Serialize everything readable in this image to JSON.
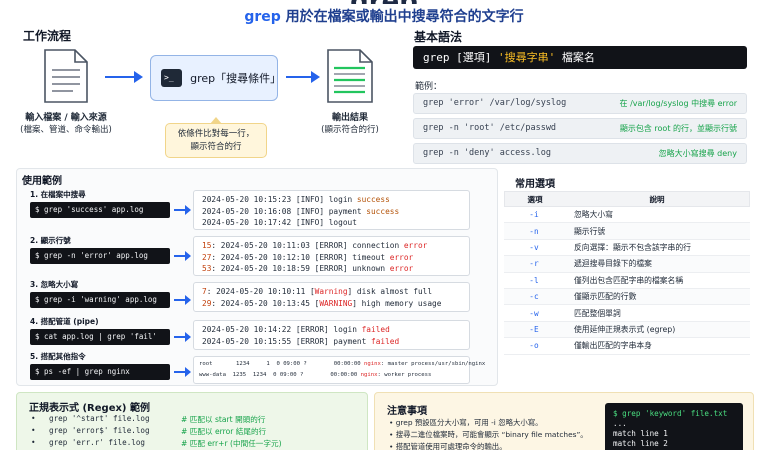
{
  "header": {
    "title": "grep",
    "subtitle_kw": "grep",
    "subtitle_rest": " 用於在檔案或輸出中搜尋符合的文字行"
  },
  "workflow": {
    "title": "工作流程",
    "input_label": "輸入檔案 / 輸入來源",
    "input_sub": "(檔案、管道、命令輸出)",
    "grep_label": "grep「搜尋條件」",
    "note": [
      "依條件比對每一行，",
      "顯示符合的行"
    ],
    "output_label": "輸出結果",
    "output_sub": "(顯示符合的行)"
  },
  "syntax": {
    "title": "基本語法",
    "bar_pre": "grep [選項] ",
    "bar_q": "'搜尋字串'",
    "bar_post": " 檔案名",
    "examples_label": "範例：",
    "examples": [
      {
        "cmd": "grep 'error' /var/log/syslog",
        "desc": "在 /var/log/syslog 中搜尋 error"
      },
      {
        "cmd": "grep -n 'root' /etc/passwd",
        "desc": "顯示包含 root 的行，並顯示行號"
      },
      {
        "cmd": "grep -n 'deny' access.log",
        "desc": "忽略大小寫搜尋 deny"
      }
    ]
  },
  "usage": {
    "title": "使用範例",
    "items": [
      {
        "title": "1. 在檔案中搜尋",
        "cmd": "$ grep 'success' app.log",
        "lines": [
          [
            "2024-05-20 10:15:23 [INFO] login ",
            "success",
            ""
          ],
          [
            "2024-05-20 10:16:08 [INFO] payment ",
            "success",
            ""
          ],
          [
            "2024-05-20 10:17:42 [INFO] logout",
            "",
            ""
          ]
        ]
      },
      {
        "title": "2. 顯示行號",
        "cmd": "$ grep -n 'error' app.log",
        "lines": [
          [
            "15",
            ": 2024-05-20 10:11:03 [ERROR] connection ",
            "error"
          ],
          [
            "27",
            ": 2024-05-20 10:12:10 [ERROR] timeout ",
            "error"
          ],
          [
            "53",
            ": 2024-05-20 10:18:59 [ERROR] unknown ",
            "error"
          ]
        ]
      },
      {
        "title": "3. 忽略大小寫",
        "cmd": "$ grep -i 'warning' app.log",
        "lines": [
          [
            "7",
            ": 2024-05-20 10:10:11 [",
            "Warning",
            "] disk almost full"
          ],
          [
            "29",
            ": 2024-05-20 10:13:45 [",
            "WARNING",
            "] high memory usage"
          ]
        ]
      },
      {
        "title": "4. 搭配管道 (pipe)",
        "cmd": "$ cat app.log | grep 'fail'",
        "lines": [
          [
            "2024-05-20 10:14:22 [ERROR] login ",
            "failed",
            ""
          ],
          [
            "2024-05-20 10:15:55 [ERROR] payment ",
            "failed",
            ""
          ]
        ]
      },
      {
        "title": "5. 搭配其他指令",
        "cmd": "$ ps -ef | grep nginx",
        "lines": [
          [
            "root       1234     1  0 09:00 ?        00:00:00 ",
            "nginx",
            ": master process/usr/sbin/nginx"
          ],
          [
            "www-data  1235  1234  0 09:00 ?        00:00:00 ",
            "nginx",
            ": worker process"
          ]
        ]
      }
    ]
  },
  "options": {
    "title": "常用選項",
    "col1": "選項",
    "col2": "說明",
    "rows": [
      {
        "opt": "-i",
        "desc": "忽略大小寫"
      },
      {
        "opt": "-n",
        "desc": "顯示行號"
      },
      {
        "opt": "-v",
        "desc": "反向選擇：顯示不包含該字串的行"
      },
      {
        "opt": "-r",
        "desc": "遞迴搜尋目錄下的檔案"
      },
      {
        "opt": "-l",
        "desc": "僅列出包含匹配字串的檔案名稱"
      },
      {
        "opt": "-c",
        "desc": "僅顯示匹配的行數"
      },
      {
        "opt": "-w",
        "desc": "匹配整個單詞"
      },
      {
        "opt": "-E",
        "desc": "使用延伸正規表示式 (egrep)"
      },
      {
        "opt": "-o",
        "desc": "僅輸出匹配的字串本身"
      }
    ]
  },
  "regex": {
    "title": "正規表示式 (Regex) 範例",
    "rows": [
      {
        "cmd": "grep '^start' file.log",
        "desc": "# 匹配以 start 開頭的行"
      },
      {
        "cmd": "grep 'error$' file.log",
        "desc": "# 匹配以 error 結尾的行"
      },
      {
        "cmd": "grep 'err.r' file.log",
        "desc": "# 匹配 err+r (中間任一字元)"
      }
    ]
  },
  "notes": {
    "title": "注意事項",
    "items": [
      "grep 預設區分大小寫，可用 -i 忽略大小寫。",
      "搜尋二進位檔案時，可能會顯示 “binary file matches”。",
      "搭配管道使用可處理命令的輸出。"
    ],
    "terminal": {
      "prompt": "$ grep 'keyword' file.txt",
      "lines": [
        "...",
        "match line 1",
        "match line 2"
      ]
    }
  }
}
